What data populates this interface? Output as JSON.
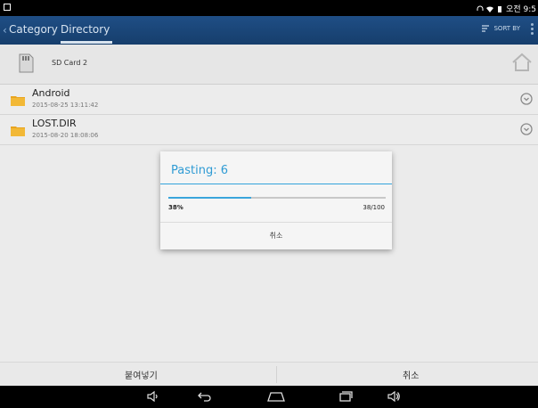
{
  "status_bar": {
    "time": "오전 9:5"
  },
  "action_bar": {
    "tabs": [
      {
        "label": "Category"
      },
      {
        "label": "Directory"
      }
    ],
    "sort_label": "SORT BY"
  },
  "path_bar": {
    "location": "SD Card 2"
  },
  "files": [
    {
      "name": "Android",
      "date": "2015-08-25 13:11:42"
    },
    {
      "name": "LOST.DIR",
      "date": "2015-08-20 18:08:06"
    }
  ],
  "dialog": {
    "title": "Pasting: 6",
    "percent_label": "38%",
    "count_label": "38/100",
    "progress_fraction": 0.38,
    "cancel_label": "취소"
  },
  "bottom_actions": {
    "paste_label": "붙여넣기",
    "cancel_label": "취소"
  },
  "colors": {
    "action_bar": "#1f4e85",
    "accent": "#33a3db",
    "folder": "#f0b429"
  },
  "icons": [
    "sd-card-icon",
    "home-icon",
    "folder-icon",
    "row-menu-icon",
    "sort-icon",
    "back-icon",
    "home-nav-icon",
    "recents-icon",
    "volume-down-icon",
    "volume-up-icon"
  ]
}
